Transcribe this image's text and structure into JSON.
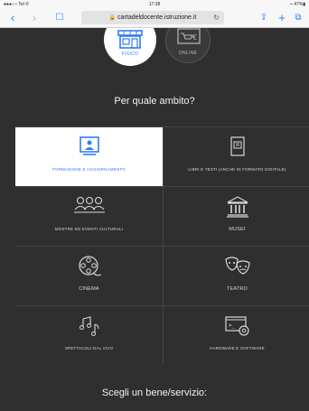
{
  "statusbar": {
    "left": "●●●○○ Tel ✆",
    "time": "17:38",
    "battery": "⌁ 47%▮"
  },
  "browser": {
    "url": "cartadeldocente.istruzione.it",
    "back": "‹",
    "forward": "›",
    "bookmarks": "☐",
    "share": "⇪",
    "new_tab": "+",
    "tabs": "⧉"
  },
  "ambito": {
    "fisico_label": "FISICO",
    "online_label": "ONLINE",
    "heading": "Per quale ambito?"
  },
  "categories": [
    {
      "label": "FORMAZIONE E AGGIORNAMENTO",
      "icon": "person-board-icon",
      "active": true
    },
    {
      "label": "LIBRI E TESTI (ANCHE IN FORMATO DIGITALE)",
      "icon": "book-icon",
      "active": false
    },
    {
      "label": "MOSTRE ED EVENTI CULTURALI",
      "icon": "group-people-icon",
      "active": false
    },
    {
      "label": "MUSEI",
      "icon": "museum-icon",
      "active": false
    },
    {
      "label": "CINEMA",
      "icon": "film-reel-icon",
      "active": false
    },
    {
      "label": "TEATRO",
      "icon": "theater-masks-icon",
      "active": false
    },
    {
      "label": "SPETTACOLI DAL VIVO",
      "icon": "music-notes-icon",
      "active": false
    },
    {
      "label": "HARDWARE E SOFTWARE",
      "icon": "hardware-software-icon",
      "active": false
    }
  ],
  "footer": {
    "heading": "Scegli un bene/servizio:"
  },
  "colors": {
    "accent": "#2f7cf6",
    "background": "#2f2f2f",
    "active_tile": "#ffffff"
  }
}
